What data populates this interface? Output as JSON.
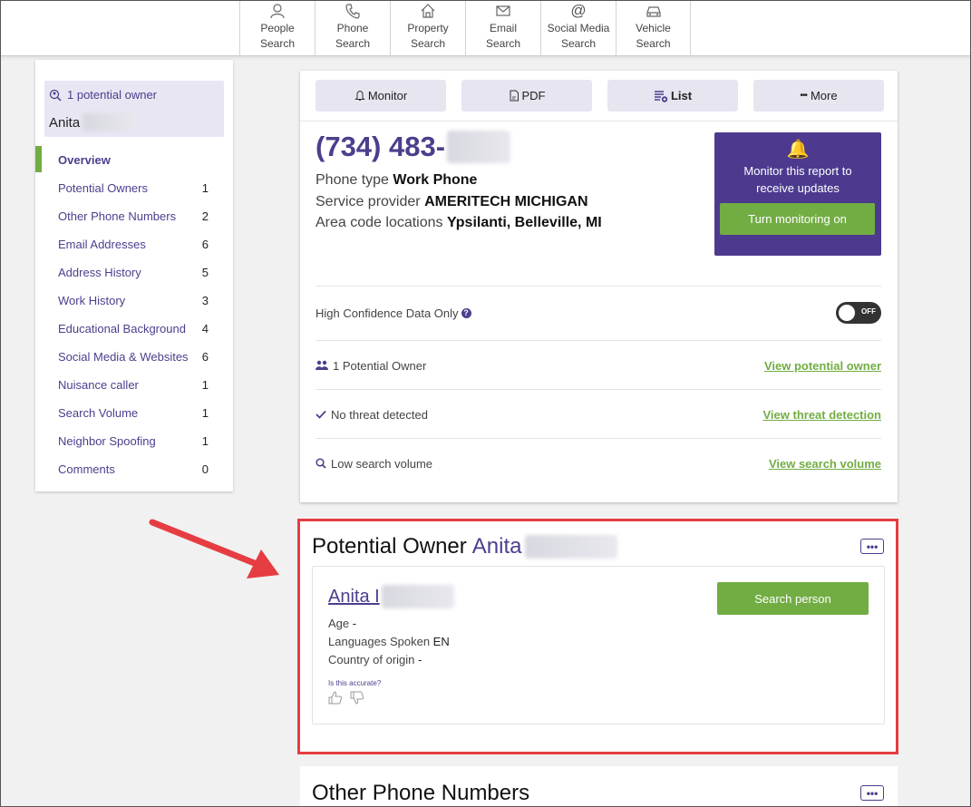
{
  "nav": [
    {
      "line1": "People",
      "line2": "Search",
      "icon": "person-icon"
    },
    {
      "line1": "Phone",
      "line2": "Search",
      "icon": "phone-icon"
    },
    {
      "line1": "Property",
      "line2": "Search",
      "icon": "house-icon"
    },
    {
      "line1": "Email",
      "line2": "Search",
      "icon": "envelope-icon"
    },
    {
      "line1": "Social Media",
      "line2": "Search",
      "icon": "at-icon"
    },
    {
      "line1": "Vehicle",
      "line2": "Search",
      "icon": "car-icon"
    }
  ],
  "sidebar": {
    "owner_count": "1 potential owner",
    "owner_name": "Anita",
    "items": [
      {
        "label": "Overview",
        "count": ""
      },
      {
        "label": "Potential Owners",
        "count": "1"
      },
      {
        "label": "Other Phone Numbers",
        "count": "2"
      },
      {
        "label": "Email Addresses",
        "count": "6"
      },
      {
        "label": "Address History",
        "count": "5"
      },
      {
        "label": "Work History",
        "count": "3"
      },
      {
        "label": "Educational Background",
        "count": "4"
      },
      {
        "label": "Social Media & Websites",
        "count": "6"
      },
      {
        "label": "Nuisance caller",
        "count": "1"
      },
      {
        "label": "Search Volume",
        "count": "1"
      },
      {
        "label": "Neighbor Spoofing",
        "count": "1"
      },
      {
        "label": "Comments",
        "count": "0"
      }
    ]
  },
  "toolbar": {
    "monitor": "Monitor",
    "pdf": "PDF",
    "list": "List",
    "more": "More"
  },
  "report": {
    "phone": "(734) 483-",
    "phone_type_label": "Phone type",
    "phone_type": "Work Phone",
    "provider_label": "Service provider",
    "provider": "AMERITECH MICHIGAN",
    "area_label": "Area code locations",
    "area": "Ypsilanti, Belleville, MI"
  },
  "monitor_box": {
    "line1": "Monitor this report to",
    "line2": "receive updates",
    "button": "Turn monitoring on"
  },
  "rows": {
    "confidence_label": "High Confidence Data Only",
    "toggle_text": "OFF",
    "owner_label": "1 Potential Owner",
    "owner_link": "View potential owner",
    "threat_label": "No threat detected",
    "threat_link": "View threat detection",
    "volume_label": "Low search volume",
    "volume_link": "View search volume"
  },
  "owner_section": {
    "title": "Potential Owner",
    "title_name": "Anita",
    "dots": "•••",
    "name": "Anita I",
    "search_button": "Search person",
    "age_label": "Age",
    "age": "-",
    "lang_label": "Languages Spoken",
    "lang": "EN",
    "country_label": "Country of origin",
    "country": "-",
    "accurate": "Is this accurate?"
  },
  "other_section": {
    "title": "Other Phone Numbers",
    "dots": "•••"
  },
  "colors": {
    "accent": "#4a3f8c",
    "green": "#72ad43",
    "highlight": "#e53d42"
  }
}
